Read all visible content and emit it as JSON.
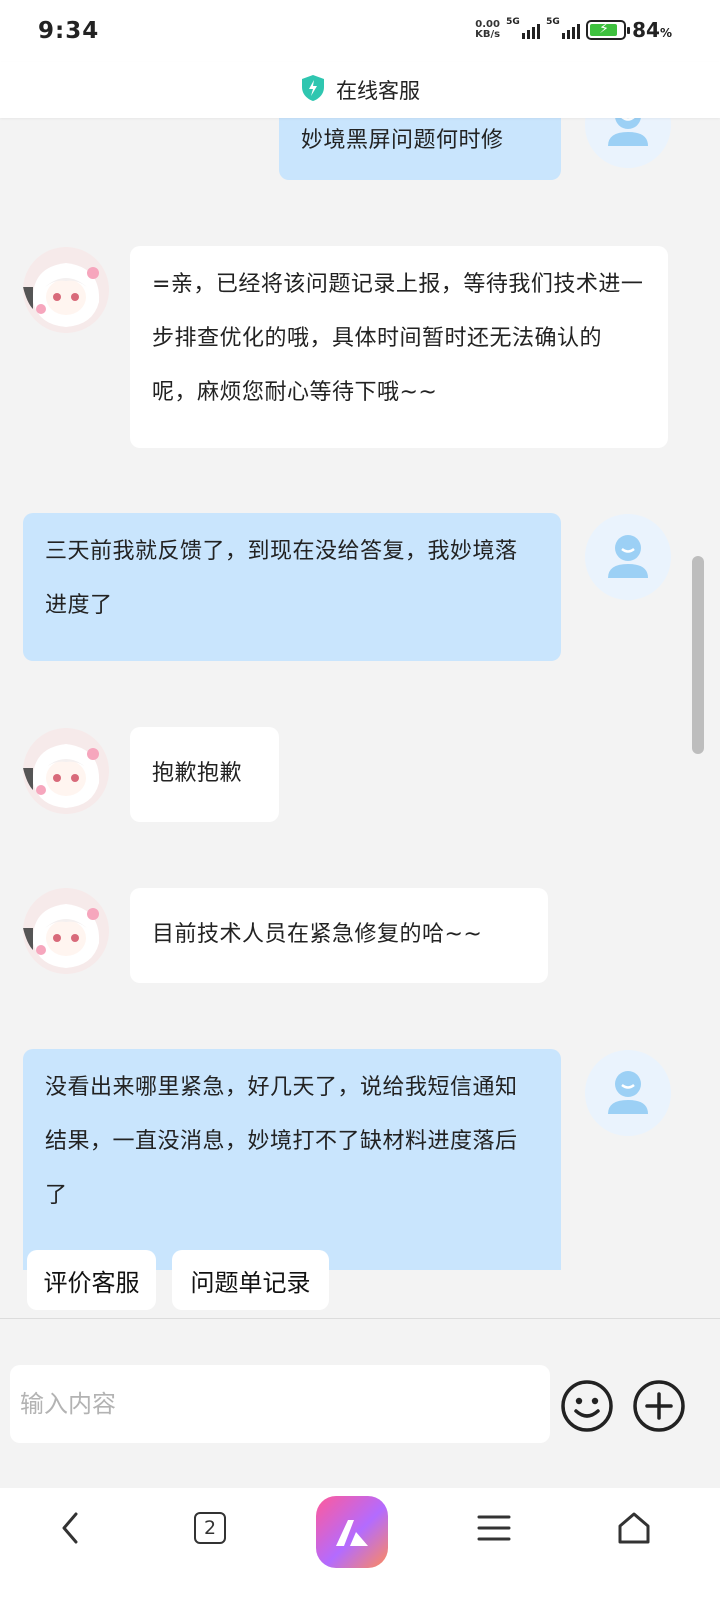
{
  "status_bar": {
    "time": "9:34",
    "net_speed_value": "0.00",
    "net_speed_unit": "KB/s",
    "signal_1_label": "5G",
    "signal_2_label": "5G",
    "battery_percent": "84",
    "battery_unit": "%",
    "battery_level": 0.84,
    "battery_color": "#3ec13e"
  },
  "header": {
    "icon": "shield-bolt-icon",
    "title": "在线客服"
  },
  "messages": [
    {
      "from": "user",
      "text": "妙境黑屏问题何时修"
    },
    {
      "from": "agent",
      "text": "=亲，已经将该问题记录上报，等待我们技术进一步排查优化的哦，具体时间暂时还无法确认的呢，麻烦您耐心等待下哦~~"
    },
    {
      "from": "user",
      "text": "三天前我就反馈了，到现在没给答复，我妙境落进度了"
    },
    {
      "from": "agent",
      "text": "抱歉抱歉"
    },
    {
      "from": "agent",
      "text": "目前技术人员在紧急修复的哈~~"
    },
    {
      "from": "user",
      "text": "没看出来哪里紧急，好几天了，说给我短信通知结果，一直没消息，妙境打不了缺材料进度落后了"
    }
  ],
  "quick_actions": [
    {
      "label": "评价客服"
    },
    {
      "label": "问题单记录"
    }
  ],
  "input": {
    "value": "",
    "placeholder": "输入内容"
  },
  "nav": {
    "back": "back-icon",
    "tabs_count": "2",
    "app": "browser-logo",
    "menu": "menu-icon",
    "home": "home-icon"
  },
  "colors": {
    "user_bubble": "#c9e5fd",
    "agent_bubble": "#ffffff",
    "background": "#f3f3f3",
    "accent": "#2fc6b0"
  }
}
